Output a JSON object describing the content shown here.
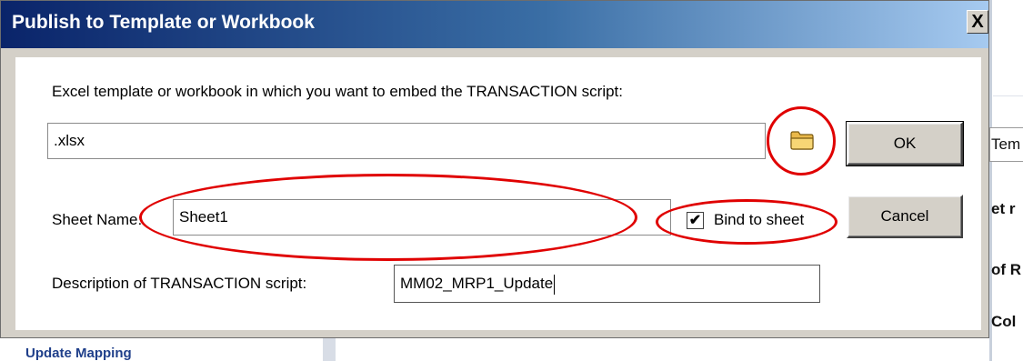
{
  "dialog": {
    "title": "Publish to Template or Workbook",
    "close_label": "X",
    "template_prompt": "Excel template or workbook in which you want to embed the TRANSACTION script:",
    "template_value": ".xlsx",
    "sheet_name_label": "Sheet Name:",
    "sheet_name_value": "Sheet1",
    "bind_label": "Bind to sheet",
    "bind_checked": true,
    "bind_check_glyph": "✔",
    "description_label": "Description of TRANSACTION script:",
    "description_value": "MM02_MRP1_Update",
    "ok_label": "OK",
    "cancel_label": "Cancel",
    "browse_icon": "folder-icon"
  },
  "background": {
    "right_fragments": [
      "Tem",
      "et r",
      "of R",
      "Col"
    ],
    "bottom_text": "Update Mapping"
  },
  "colors": {
    "titlebar_start": "#0a246a",
    "titlebar_end": "#a6caf0",
    "annotation_red": "#e00000",
    "face": "#d4d0c8"
  }
}
